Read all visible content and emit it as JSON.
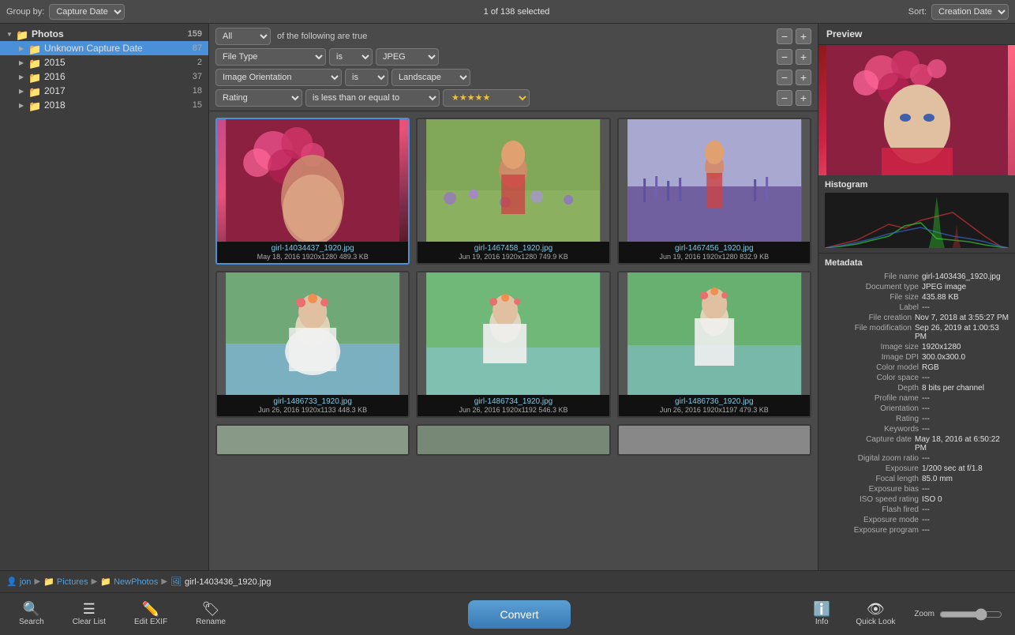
{
  "topbar": {
    "group_by_label": "Group by:",
    "group_by_value": "Capture Date",
    "selection_info": "1 of 138 selected",
    "sort_label": "Sort:",
    "sort_value": "Creation Date"
  },
  "sidebar": {
    "root_label": "Photos",
    "root_count": "159",
    "items": [
      {
        "label": "Unknown Capture Date",
        "count": "87",
        "indent": 1
      },
      {
        "label": "2015",
        "count": "2",
        "indent": 1
      },
      {
        "label": "2016",
        "count": "37",
        "indent": 1
      },
      {
        "label": "2017",
        "count": "18",
        "indent": 1
      },
      {
        "label": "2018",
        "count": "15",
        "indent": 1
      }
    ]
  },
  "filter": {
    "match_label": "All",
    "of_following": "of the following are true",
    "row1": {
      "field": "File Type",
      "op": "is",
      "value": "JPEG"
    },
    "row2": {
      "field": "Image Orientation",
      "op": "is",
      "value": "Landscape"
    },
    "row3": {
      "field": "Rating",
      "op": "is less than or equal to",
      "value": "★★★★★"
    }
  },
  "grid": {
    "images": [
      {
        "filename": "girl-14034437_1920.jpg",
        "meta": "May 18, 2016  1920x1280  489.3 KB",
        "selected": true,
        "color": "linear-gradient(160deg, #c84b8a 0%, #e8527a 40%, #7b2d4a 80%, #5a1a2a 100%)"
      },
      {
        "filename": "girl-1467458_1920.jpg",
        "meta": "Jun 19, 2016  1920x1280  749.9 KB",
        "selected": false,
        "color": "linear-gradient(160deg, #7ab84a 0%, #a8d060 30%, #c8b870 60%, #8a6a30 100%)"
      },
      {
        "filename": "girl-1467456_1920.jpg",
        "meta": "Jun 19, 2016  1920x1280  832.9 KB",
        "selected": false,
        "color": "linear-gradient(160deg, #9090c0 0%, #b0a0d0 30%, #c0b0e0 60%, #7080a0 100%)"
      },
      {
        "filename": "girl-1486733_1920.jpg",
        "meta": "Jun 26, 2016  1920x1133  448.3 KB",
        "selected": false,
        "color": "linear-gradient(160deg, #4a8a4a 0%, #70b060 30%, #c0d0b0 60%, #a0c090 100%)"
      },
      {
        "filename": "girl-1486734_1920.jpg",
        "meta": "Jun 26, 2016  1920x1192  546.3 KB",
        "selected": false,
        "color": "linear-gradient(160deg, #5a9060 0%, #8ab080 30%, #c0d8b0 60%, #70a060 100%)"
      },
      {
        "filename": "girl-1486736_1920.jpg",
        "meta": "Jun 26, 2016  1920x1197  479.3 KB",
        "selected": false,
        "color": "linear-gradient(160deg, #4a8060 0%, #80b090 30%, #c0d8c0 60%, #60a080 100%)"
      },
      {
        "filename": "",
        "meta": "",
        "selected": false,
        "color": "linear-gradient(160deg, #888 0%, #aaa 50%, #888 100%)"
      },
      {
        "filename": "",
        "meta": "",
        "selected": false,
        "color": "linear-gradient(160deg, #777 0%, #999 50%, #666 100%)"
      },
      {
        "filename": "",
        "meta": "",
        "selected": false,
        "color": "linear-gradient(160deg, #888 0%, #bbb 50%, #777 100%)"
      }
    ]
  },
  "preview": {
    "title": "Preview",
    "histogram_title": "Histogram",
    "metadata_title": "Metadata",
    "fields": [
      {
        "key": "File name",
        "val": "girl-1403436_1920.jpg"
      },
      {
        "key": "Document type",
        "val": "JPEG image"
      },
      {
        "key": "File size",
        "val": "435.88 KB"
      },
      {
        "key": "Label",
        "val": "---"
      },
      {
        "key": "File creation",
        "val": "Nov 7, 2018 at 3:55:27 PM"
      },
      {
        "key": "File modification",
        "val": "Sep 26, 2019 at 1:00:53 PM"
      },
      {
        "key": "Image size",
        "val": "1920x1280"
      },
      {
        "key": "Image DPI",
        "val": "300.0x300.0"
      },
      {
        "key": "Color model",
        "val": "RGB"
      },
      {
        "key": "Color space",
        "val": "---"
      },
      {
        "key": "Depth",
        "val": "8 bits per channel"
      },
      {
        "key": "Profile name",
        "val": "---"
      },
      {
        "key": "Orientation",
        "val": "---"
      },
      {
        "key": "Rating",
        "val": "---"
      },
      {
        "key": "Keywords",
        "val": "---"
      },
      {
        "key": "Capture date",
        "val": "May 18, 2016 at 6:50:22 PM"
      },
      {
        "key": "Digital zoom ratio",
        "val": "---"
      },
      {
        "key": "Exposure",
        "val": "1/200 sec at f/1.8"
      },
      {
        "key": "Focal length",
        "val": "85.0 mm"
      },
      {
        "key": "Exposure bias",
        "val": "---"
      },
      {
        "key": "ISO speed rating",
        "val": "ISO 0"
      },
      {
        "key": "Flash fired",
        "val": "---"
      },
      {
        "key": "Exposure mode",
        "val": "---"
      },
      {
        "key": "Exposure program",
        "val": "---"
      }
    ]
  },
  "status_bar": {
    "breadcrumb": [
      {
        "text": "jon",
        "type": "user"
      },
      {
        "text": "▶",
        "type": "sep"
      },
      {
        "text": "Pictures",
        "type": "folder"
      },
      {
        "text": "▶",
        "type": "sep"
      },
      {
        "text": "NewPhotos",
        "type": "folder"
      },
      {
        "text": "▶",
        "type": "sep"
      },
      {
        "text": "girl-1403436_1920.jpg",
        "type": "file"
      }
    ]
  },
  "toolbar": {
    "search_label": "Search",
    "clear_list_label": "Clear List",
    "edit_exif_label": "Edit EXIF",
    "rename_label": "Rename",
    "convert_label": "Convert",
    "info_label": "Info",
    "quick_look_label": "Quick Look",
    "zoom_label": "Zoom"
  }
}
